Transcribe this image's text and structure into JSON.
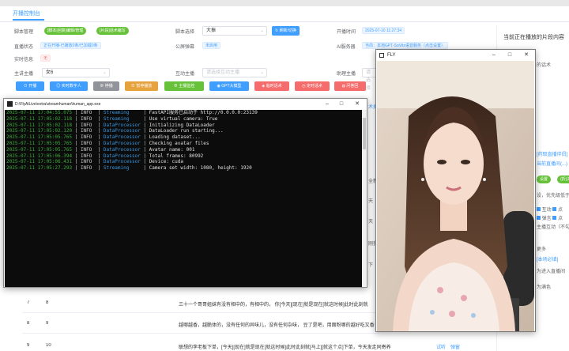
{
  "page": {
    "tab": "开播控制台",
    "right_title": "当前正在播放的片段内容"
  },
  "form": {
    "script_mgmt_label": "脚本管理",
    "script_mgmt_btn": "[脚本|回复|编辑/管理",
    "speech_write_btn": "[片段]话术编写",
    "script_select_label": "脚本选择",
    "script_select_value": "大振",
    "refresh_btn": "刷新/切换",
    "start_time_label": "开播时间",
    "start_time_value": "2025-07-10 11:27:34",
    "live_status_label": "直播状态",
    "live_status_value": "正在开播-已播放0条/已加载0条",
    "public_tts_label": "公屏弹幕",
    "public_tts_value": "未启用",
    "ai_server_label": "AI服务器",
    "ai_server_value": "当前：本地GPT-SoVits语音服务（点击设置）",
    "realtime_label": "实时信息",
    "realtime_value": "无",
    "main_host_label": "主讲主播",
    "main_host_value": "女6",
    "interact_label": "互动主播",
    "interact_placeholder": "请选择互动主播",
    "assist_label": "助理主播",
    "assist_placeholder": "请选择"
  },
  "actions": [
    {
      "label": "开播",
      "icon": "play-icon",
      "color": "#409eff"
    },
    {
      "label": "实时数字人",
      "icon": "user-icon",
      "color": "#409eff"
    },
    {
      "label": "停播",
      "icon": "stop-icon",
      "color": "#909399"
    },
    {
      "label": "暂停播放",
      "icon": "pause-icon",
      "color": "#e6a23c"
    },
    {
      "label": "主播监控",
      "icon": "monitor-icon",
      "color": "#67c23a"
    },
    {
      "label": "GPT大模型",
      "icon": "robot-icon",
      "color": "#409eff"
    },
    {
      "label": "临时话术",
      "icon": "message-icon",
      "color": "#f56c6c"
    },
    {
      "label": "定时话术",
      "icon": "clock-icon",
      "color": "#f56c6c"
    },
    {
      "label": "问答回",
      "icon": "reply-icon",
      "color": "#f56c6c"
    }
  ],
  "right_panel": {
    "fragment": "的话术",
    "set_host": "[药取直播伴侣]",
    "set_host2": "当前直播间(...)",
    "btn1": "设置",
    "btn2": "(折)关",
    "priority": "设，优先级低于",
    "chk1": "互动",
    "chk2": "点",
    "chk3": "弹言",
    "chk4": "点",
    "note": "主播互动（不勾选",
    "more": "更多",
    "more_link": "[本场必填]",
    "enter": "为进入直播间",
    "reminder": "为满色"
  },
  "console": {
    "title": "D:\\FlyAiLive\\extra\\streamhuman\\human_app.exe",
    "lines": [
      {
        "ts": "2025-07-11 17:04:55.075",
        "level": "INFO",
        "module": "Streaming",
        "msg": "FastAPI服务已启动于 http://0.0.0.0:23139"
      },
      {
        "ts": "2025-07-11 17:05:02.118",
        "level": "INFO",
        "module": "Streaming",
        "msg": "Use virtual camera: True"
      },
      {
        "ts": "2025-07-11 17:05:02.118",
        "level": "INFO",
        "module": "DataProcessor",
        "msg": "Initializing DataLoader"
      },
      {
        "ts": "2025-07-11 17:05:02.120",
        "level": "INFO",
        "module": "DataProcessor",
        "msg": "DataLoader run starting..."
      },
      {
        "ts": "2025-07-11 17:05:05.765",
        "level": "INFO",
        "module": "DataProcessor",
        "msg": "Loading dataset..."
      },
      {
        "ts": "2025-07-11 17:05:05.765",
        "level": "INFO",
        "module": "DataProcessor",
        "msg": "Checking avatar files"
      },
      {
        "ts": "2025-07-11 17:05:05.765",
        "level": "INFO",
        "module": "DataProcessor",
        "msg": "Avatar name: 001"
      },
      {
        "ts": "2025-07-11 17:05:06.394",
        "level": "INFO",
        "module": "DataProcessor",
        "msg": "Total frames: 80992"
      },
      {
        "ts": "2025-07-11 17:05:06.431",
        "level": "INFO",
        "module": "DataProcessor",
        "msg": "Device: cuda"
      },
      {
        "ts": "2025-07-11 17:05:27.293",
        "level": "INFO",
        "module": "Streaming",
        "msg": "Camera set width: 1080, height: 1920"
      }
    ]
  },
  "fly_window": {
    "title": "FLY"
  },
  "side_col": {
    "r1": "术类",
    "r2": "全新",
    "r3": "天",
    "r4": "天",
    "r5": "刚我",
    "r6": "下"
  },
  "table_rows": [
    {
      "idx": "7",
      "no": "8",
      "text": "三十一个哥哥姐妹有没有相中的，有相中的，  你[今天][现在]就是现在[就这时候]此时此刻就",
      "a1": "",
      "a2": ""
    },
    {
      "idx": "8",
      "no": "9",
      "text": "越哪越香，越脆体的，没有任何的异味儿，没有任何杂味，  豆了是吧，用面粉哪的越好吃又香",
      "a1": "",
      "a2": ""
    },
    {
      "idx": "9",
      "no": "10",
      "text": "联想的李老板下单，[今天][现在]就是现在[就这时候]此时此刻就[马上][就这个点]下单，今天发走同寄养",
      "a1": "试听",
      "a2": "弹窗"
    }
  ]
}
